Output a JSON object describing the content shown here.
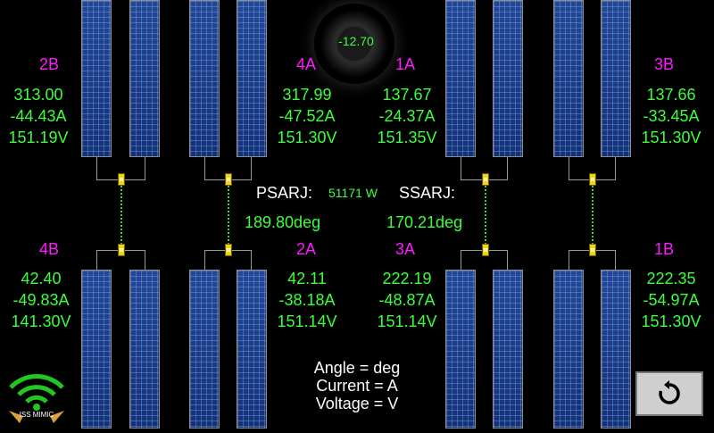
{
  "beta_angle": "-12.70",
  "power": "51171 W",
  "psarj": {
    "label": "PSARJ:",
    "value": "189.80deg"
  },
  "ssarj": {
    "label": "SSARJ:",
    "value": "170.21deg"
  },
  "arrays": {
    "a2B": {
      "name": "2B",
      "angle": "313.00",
      "current": "-44.43A",
      "voltage": "151.19V"
    },
    "a4A": {
      "name": "4A",
      "angle": "317.99",
      "current": "-47.52A",
      "voltage": "151.30V"
    },
    "a1A": {
      "name": "1A",
      "angle": "137.67",
      "current": "-24.37A",
      "voltage": "151.35V"
    },
    "a3B": {
      "name": "3B",
      "angle": "137.66",
      "current": "-33.45A",
      "voltage": "151.30V"
    },
    "a4B": {
      "name": "4B",
      "angle": "42.40",
      "current": "-49.83A",
      "voltage": "141.30V"
    },
    "a2A": {
      "name": "2A",
      "angle": "42.11",
      "current": "-38.18A",
      "voltage": "151.14V"
    },
    "a3A": {
      "name": "3A",
      "angle": "222.19",
      "current": "-48.87A",
      "voltage": "151.14V"
    },
    "a1B": {
      "name": "1B",
      "angle": "222.35",
      "current": "-54.97A",
      "voltage": "151.30V"
    }
  },
  "legend": {
    "angle": "Angle = deg",
    "current": "Current = A",
    "voltage": "Voltage = V"
  },
  "logo_text": "ISS MIMIC",
  "icons": {
    "back": "refresh-icon",
    "logo": "wifi-logo-icon"
  }
}
